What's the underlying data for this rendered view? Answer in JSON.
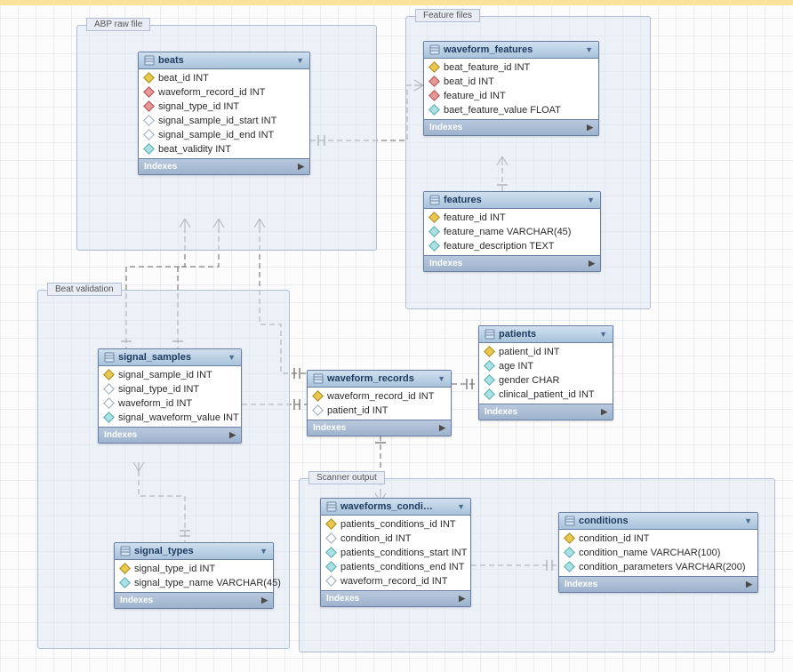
{
  "groups": {
    "abp": {
      "label": "ABP raw file"
    },
    "feat": {
      "label": "Feature files"
    },
    "beatval": {
      "label": "Beat validation"
    },
    "scan": {
      "label": "Scanner output"
    }
  },
  "indexes_label": "Indexes",
  "tables": {
    "beats": {
      "title": "beats",
      "cols": [
        {
          "icon": "key",
          "text": "beat_id INT"
        },
        {
          "icon": "fk-red",
          "text": "waveform_record_id INT"
        },
        {
          "icon": "fk-red",
          "text": "signal_type_id INT"
        },
        {
          "icon": "diamond-hollow",
          "text": "signal_sample_id_start INT"
        },
        {
          "icon": "diamond-hollow",
          "text": "signal_sample_id_end INT"
        },
        {
          "icon": "diamond-cyan",
          "text": "beat_validity INT"
        }
      ]
    },
    "waveform_features": {
      "title": "waveform_features",
      "cols": [
        {
          "icon": "key",
          "text": "beat_feature_id INT"
        },
        {
          "icon": "fk-red",
          "text": "beat_id INT"
        },
        {
          "icon": "fk-red",
          "text": "feature_id INT"
        },
        {
          "icon": "diamond-cyan",
          "text": "baet_feature_value FLOAT"
        }
      ]
    },
    "features": {
      "title": "features",
      "cols": [
        {
          "icon": "key",
          "text": "feature_id INT"
        },
        {
          "icon": "diamond-cyan",
          "text": "feature_name VARCHAR(45)"
        },
        {
          "icon": "diamond-cyan",
          "text": "feature_description TEXT"
        }
      ]
    },
    "signal_samples": {
      "title": "signal_samples",
      "cols": [
        {
          "icon": "key",
          "text": "signal_sample_id INT"
        },
        {
          "icon": "diamond-hollow",
          "text": "signal_type_id INT"
        },
        {
          "icon": "diamond-hollow",
          "text": "waveform_id INT"
        },
        {
          "icon": "diamond-cyan",
          "text": "signal_waveform_value INT"
        }
      ]
    },
    "waveform_records": {
      "title": "waveform_records",
      "cols": [
        {
          "icon": "key",
          "text": "waveform_record_id INT"
        },
        {
          "icon": "diamond-hollow",
          "text": "patient_id INT"
        }
      ]
    },
    "patients": {
      "title": "patients",
      "cols": [
        {
          "icon": "key",
          "text": "patient_id INT"
        },
        {
          "icon": "diamond-cyan",
          "text": "age INT"
        },
        {
          "icon": "diamond-cyan",
          "text": "gender CHAR"
        },
        {
          "icon": "diamond-cyan",
          "text": "clinical_patient_id INT"
        }
      ]
    },
    "signal_types": {
      "title": "signal_types",
      "cols": [
        {
          "icon": "key",
          "text": "signal_type_id INT"
        },
        {
          "icon": "diamond-cyan",
          "text": "signal_type_name VARCHAR(45)"
        }
      ]
    },
    "waveforms_conditions": {
      "title": "waveforms_condi…",
      "cols": [
        {
          "icon": "key",
          "text": "patients_conditions_id INT"
        },
        {
          "icon": "diamond-hollow",
          "text": "condition_id INT"
        },
        {
          "icon": "diamond-cyan",
          "text": "patients_conditions_start INT"
        },
        {
          "icon": "diamond-cyan",
          "text": "patients_conditions_end INT"
        },
        {
          "icon": "diamond-hollow",
          "text": "waveform_record_id INT"
        }
      ]
    },
    "conditions": {
      "title": "conditions",
      "cols": [
        {
          "icon": "key",
          "text": "condition_id INT"
        },
        {
          "icon": "diamond-cyan",
          "text": "condition_name VARCHAR(100)"
        },
        {
          "icon": "diamond-cyan",
          "text": "condition_parameters VARCHAR(200)"
        }
      ]
    }
  }
}
